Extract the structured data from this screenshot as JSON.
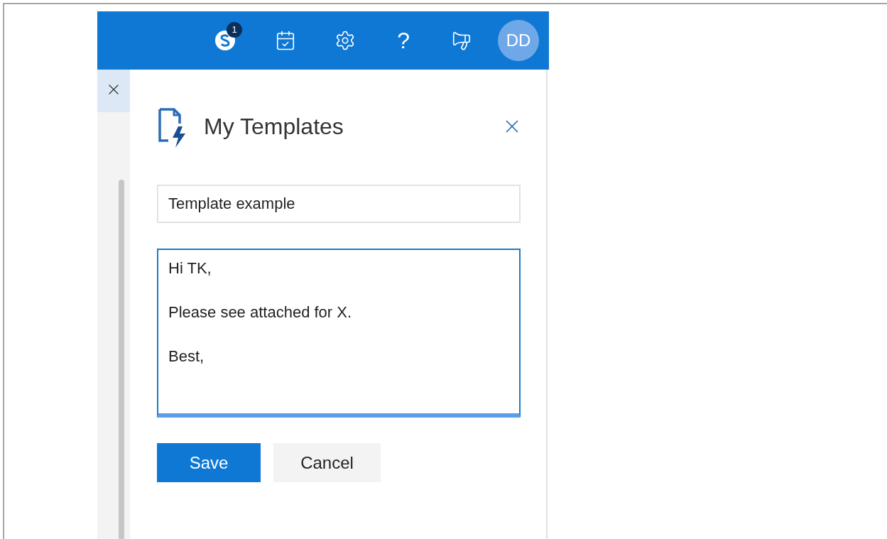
{
  "topbar": {
    "skype_badge": "1",
    "help": "?",
    "avatar": "DD"
  },
  "panel": {
    "title": "My Templates",
    "name_field": {
      "value": "Template example"
    },
    "body_field": {
      "lines": [
        "Hi TK,",
        "Please see attached for X.",
        "Best,"
      ],
      "focused": true
    },
    "buttons": [
      {
        "label": "Save",
        "kind": "primary"
      },
      {
        "label": "Cancel",
        "kind": "secondary"
      }
    ]
  }
}
